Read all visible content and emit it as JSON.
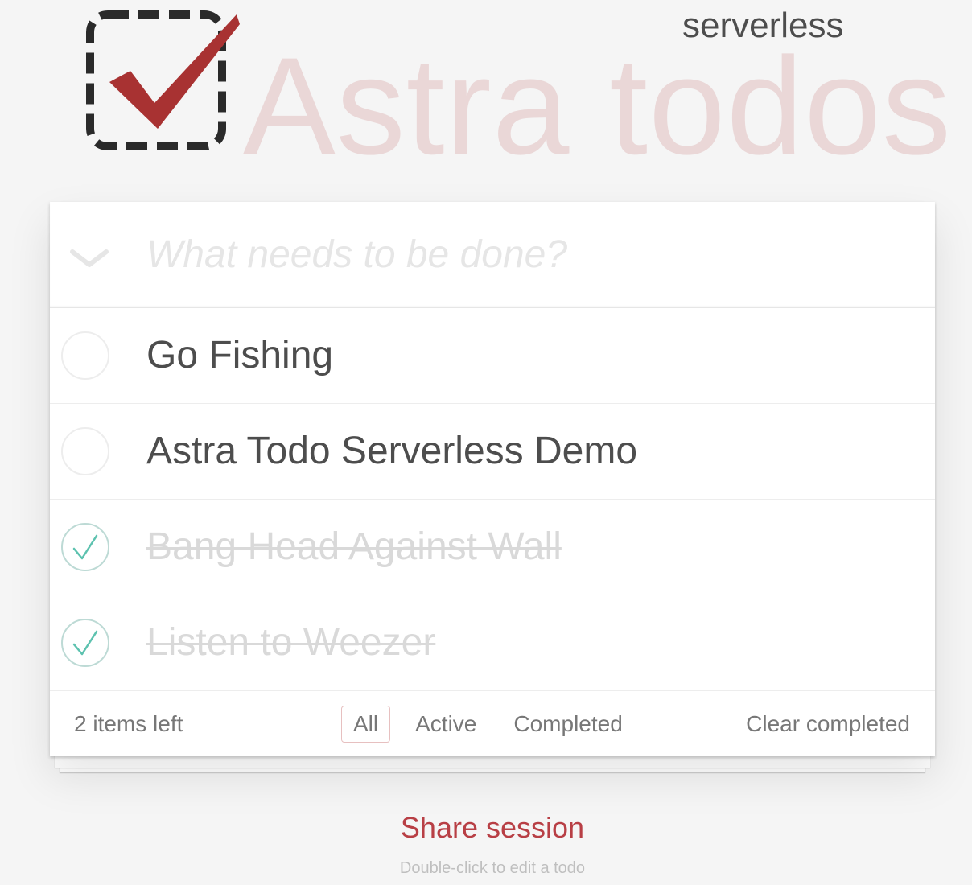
{
  "header": {
    "logo_icon": "dashed-checkbox-check-icon",
    "subtitle": "serverless",
    "title": "Astra todos",
    "accent_color": "#af2f2f"
  },
  "new_todo": {
    "toggle_all_icon": "chevron-down-icon",
    "placeholder": "What needs to be done?",
    "value": ""
  },
  "todos": [
    {
      "label": "Go Fishing",
      "completed": false
    },
    {
      "label": "Astra Todo Serverless Demo",
      "completed": false
    },
    {
      "label": "Bang Head Against Wall",
      "completed": true
    },
    {
      "label": "Listen to Weezer",
      "completed": true
    }
  ],
  "footer": {
    "items_left": "2 items left",
    "filters": [
      {
        "label": "All",
        "selected": true
      },
      {
        "label": "Active",
        "selected": false
      },
      {
        "label": "Completed",
        "selected": false
      }
    ],
    "clear_completed": "Clear completed"
  },
  "share_session": "Share session",
  "hint": "Double-click to edit a todo",
  "colors": {
    "check_green": "#5dc2af",
    "share_red": "#b83f45"
  }
}
